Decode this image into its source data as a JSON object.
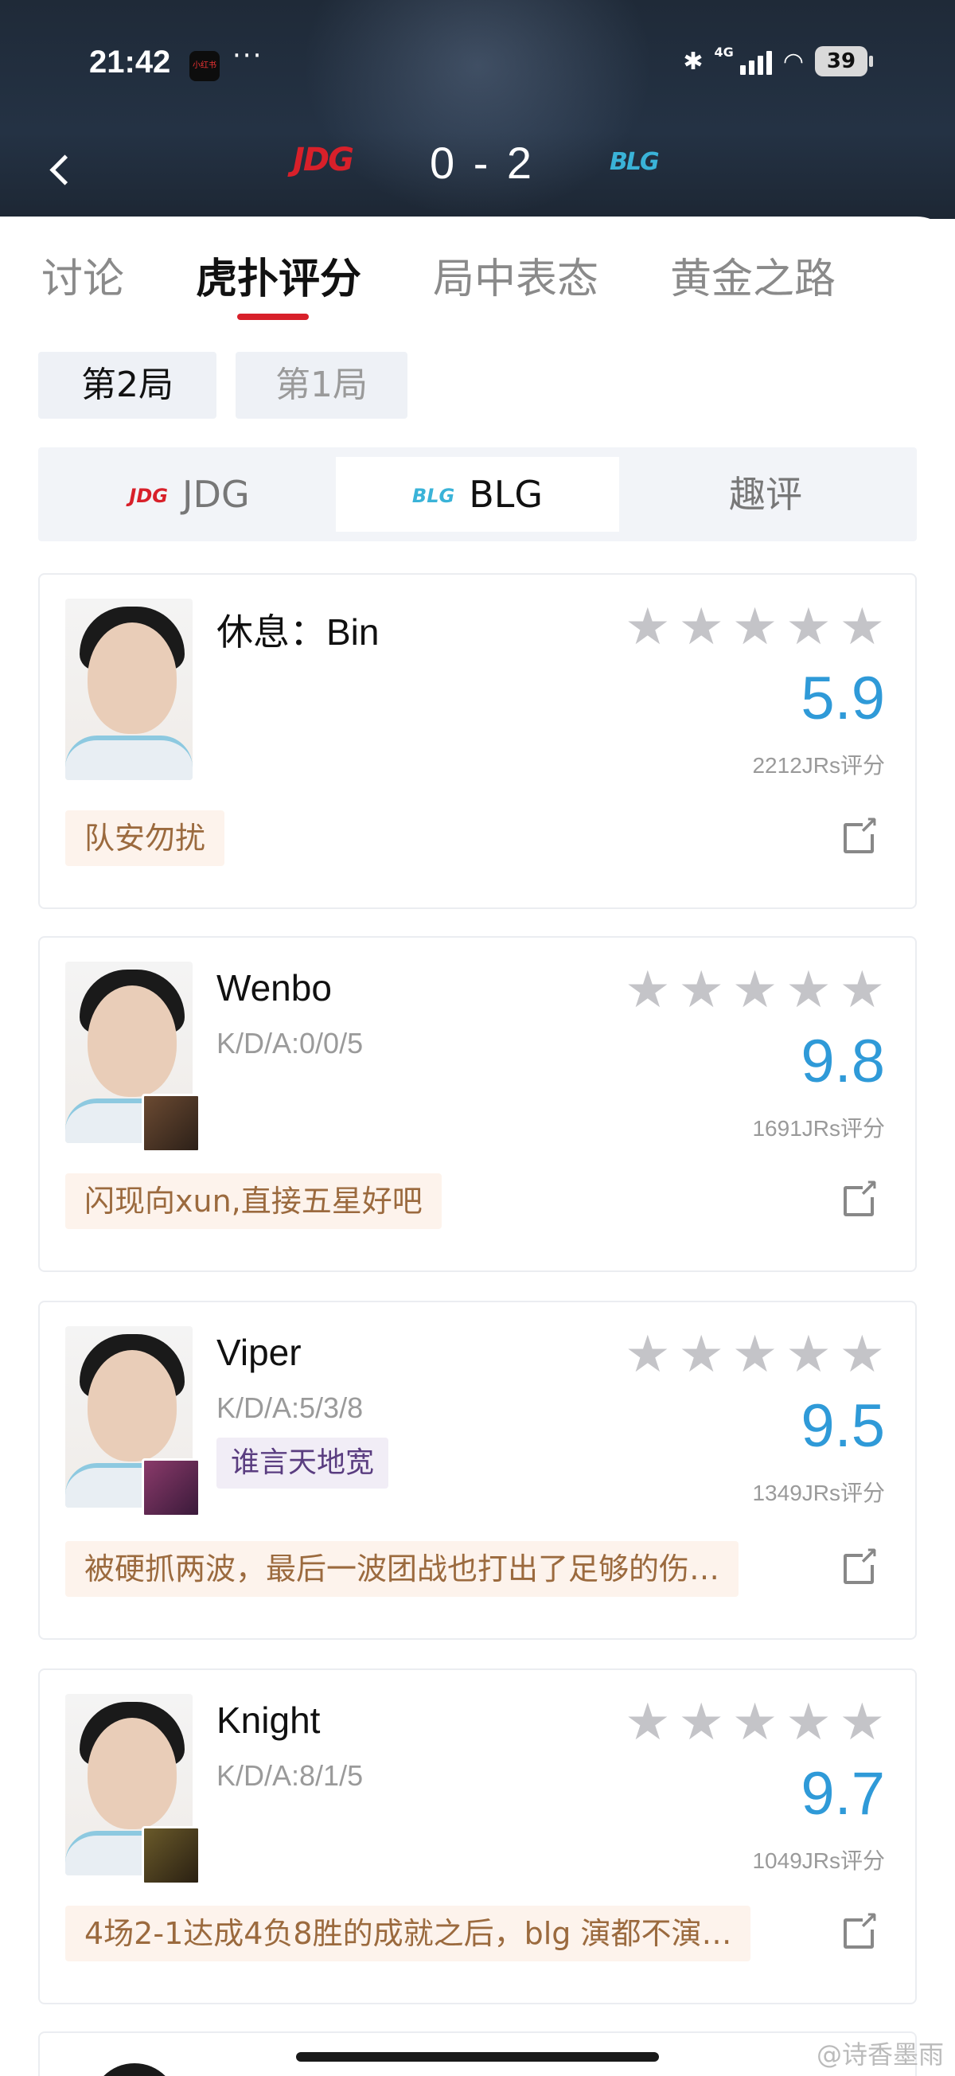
{
  "status_bar": {
    "time": "21:42",
    "app_badge": "小红书",
    "more": "···",
    "network": "4G",
    "battery": "39"
  },
  "match": {
    "team_left_logo": "JDG",
    "score": "0 - 2",
    "team_right_logo": "BLG",
    "colors": {
      "jdg": "#d8202a",
      "blg": "#3ab3d8"
    }
  },
  "tabs": [
    {
      "label": "讨论"
    },
    {
      "label": "虎扑评分"
    },
    {
      "label": "局中表态"
    },
    {
      "label": "黄金之路"
    }
  ],
  "games": [
    {
      "label": "第2局"
    },
    {
      "label": "第1局"
    }
  ],
  "team_switch": {
    "jdg": {
      "logo": "JDG",
      "label": "JDG"
    },
    "blg": {
      "logo": "BLG",
      "label": "BLG"
    },
    "fun": {
      "label": "趣评"
    }
  },
  "players": [
    {
      "name": "休息：Bin",
      "kda": "",
      "badge": "",
      "rating": "5.9",
      "votes": "2212JRs评分",
      "comment": "队安勿扰"
    },
    {
      "name": "Wenbo",
      "kda": "K/D/A:0/0/5",
      "badge": "",
      "rating": "9.8",
      "votes": "1691JRs评分",
      "comment": "闪现向xun,直接五星好吧"
    },
    {
      "name": "Viper",
      "kda": "K/D/A:5/3/8",
      "badge": "谁言天地宽",
      "rating": "9.5",
      "votes": "1349JRs评分",
      "comment": "被硬抓两波，最后一波团战也打出了足够的伤…"
    },
    {
      "name": "Knight",
      "kda": "K/D/A:8/1/5",
      "badge": "",
      "rating": "9.7",
      "votes": "1049JRs评分",
      "comment": "4场2-1达成4负8胜的成就之后，blg 演都不演…"
    }
  ],
  "watermark": "@诗香墨雨"
}
